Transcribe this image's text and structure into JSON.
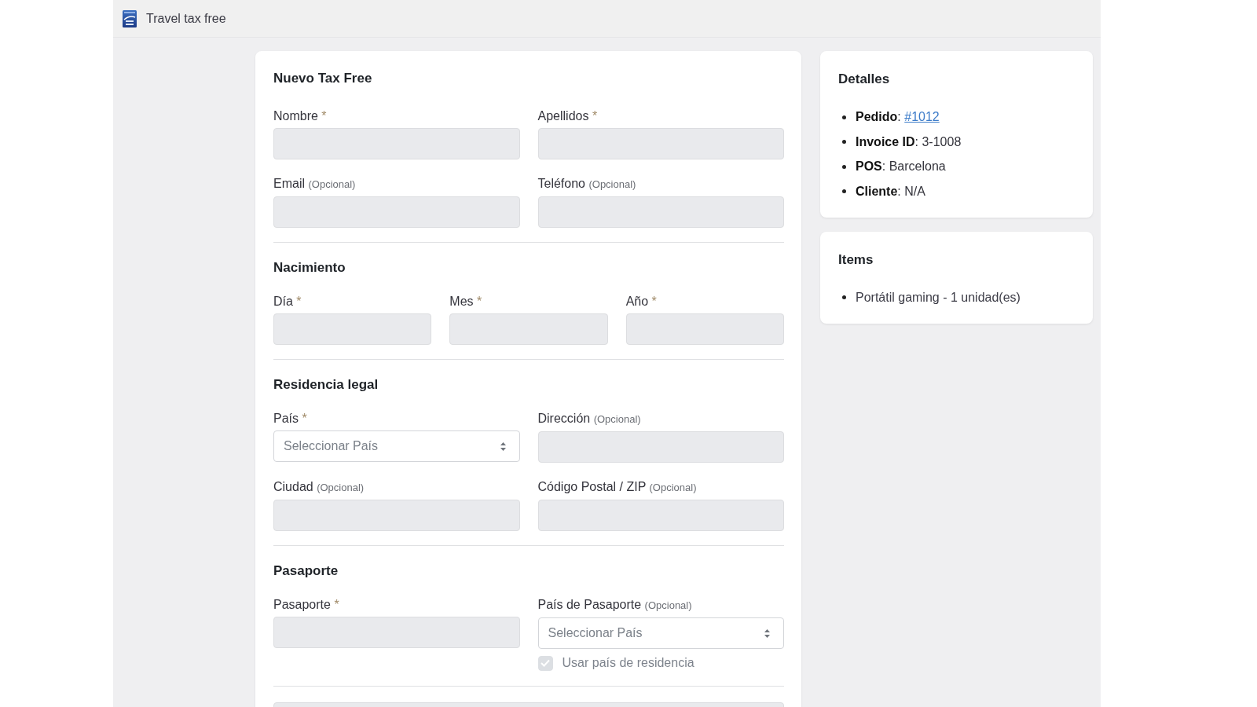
{
  "app_bar": {
    "title": "Travel tax free"
  },
  "form": {
    "title": "Nuevo Tax Free",
    "sections": [
      {
        "fields": [
          {
            "kind": "text",
            "label": "Nombre",
            "marker": "*",
            "disabled": true
          },
          {
            "kind": "text",
            "label": "Apellidos",
            "marker": "*",
            "disabled": true
          },
          {
            "kind": "text",
            "label": "Email",
            "note": "(Opcional)",
            "disabled": true
          },
          {
            "kind": "text",
            "label": "Teléfono",
            "note": "(Opcional)",
            "disabled": true
          }
        ]
      },
      {
        "heading": "Nacimiento",
        "fields": [
          {
            "kind": "text",
            "label": "Día",
            "marker": "*",
            "disabled": true
          },
          {
            "kind": "text",
            "label": "Mes",
            "marker": "*",
            "disabled": true
          },
          {
            "kind": "text",
            "label": "Año",
            "marker": "*",
            "disabled": true
          }
        ]
      },
      {
        "heading": "Residencia legal",
        "fields": [
          {
            "kind": "select",
            "label": "País",
            "marker": "*",
            "placeholder": "Seleccionar País",
            "disabled": false
          },
          {
            "kind": "text",
            "label": "Dirección",
            "note": "(Opcional)",
            "disabled": true
          },
          {
            "kind": "text",
            "label": "Ciudad",
            "note": "(Opcional)",
            "disabled": true
          },
          {
            "kind": "text",
            "label": "Código Postal / ZIP",
            "note": "(Opcional)",
            "disabled": true
          }
        ]
      },
      {
        "heading": "Pasaporte",
        "fields": [
          {
            "kind": "text",
            "label": "Pasaporte",
            "marker": "*",
            "disabled": true
          },
          {
            "kind": "select",
            "label": "País de Pasaporte",
            "note": "(Opcional)",
            "placeholder": "Seleccionar País",
            "disabled": false,
            "checkbox": {
              "label": "Usar país de residencia",
              "checked": true,
              "disabled": true
            }
          }
        ]
      }
    ],
    "bottom_field": {
      "disabled": true
    }
  },
  "details": {
    "title": "Detalles",
    "rows": [
      {
        "kind": "link",
        "text": "**Pedido**:",
        "link": "#1012"
      },
      {
        "kind": "text",
        "text": "**Invoice ID**: 3-1008"
      },
      {
        "kind": "text",
        "text": "**POS**: Barcelona"
      },
      {
        "kind": "text",
        "text": "**Cliente**: N/A"
      }
    ]
  },
  "items": {
    "title": "Items",
    "rows": [
      {
        "text": "Portátil gaming - 1 unidad(es)"
      }
    ]
  }
}
